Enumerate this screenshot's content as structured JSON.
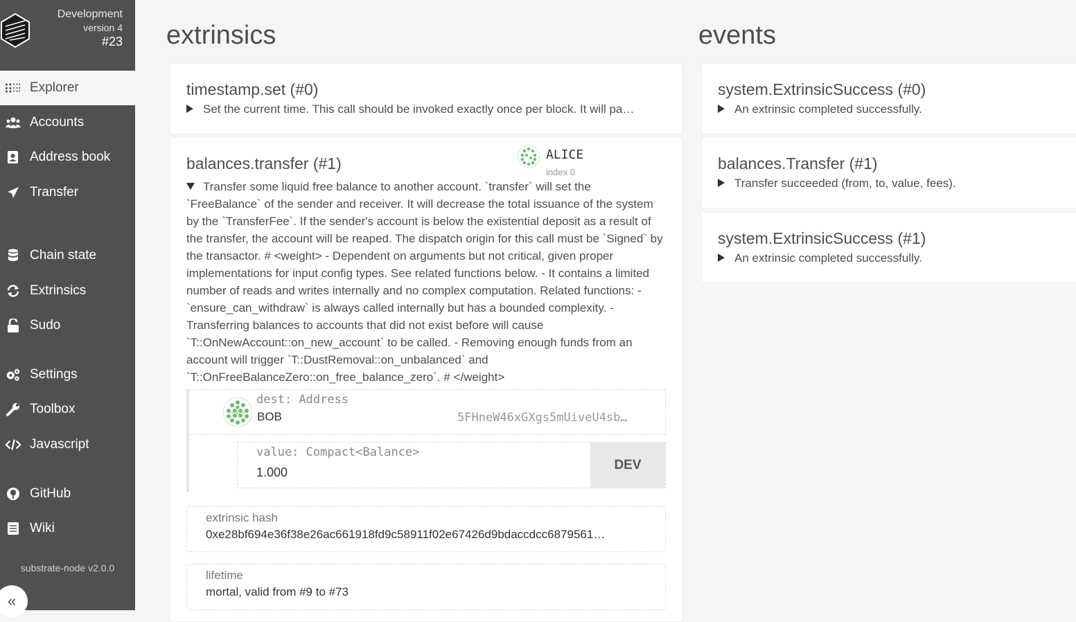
{
  "chain": {
    "name": "Development",
    "version": "version 4",
    "block": "#23"
  },
  "nav": {
    "explorer": "Explorer",
    "accounts": "Accounts",
    "address_book": "Address book",
    "transfer": "Transfer",
    "chain_state": "Chain state",
    "extrinsics": "Extrinsics",
    "sudo": "Sudo",
    "settings": "Settings",
    "toolbox": "Toolbox",
    "javascript": "Javascript",
    "github": "GitHub",
    "wiki": "Wiki"
  },
  "footer": {
    "node_version": "substrate-node v2.0.0",
    "collapse_label": "«"
  },
  "main": {
    "extrinsics_title": "extrinsics",
    "events_title": "events"
  },
  "extrinsics": [
    {
      "title": "timestamp.set (#0)",
      "desc": "Set the current time. This call should be invoked exactly once per block. It will pa…"
    },
    {
      "title": "balances.transfer (#1)",
      "signer_name": "ALICE",
      "signer_index": "index 0",
      "desc": "Transfer some liquid free balance to another account. `transfer` will set the `FreeBalance` of the sender and receiver. It will decrease the total issuance of the system by the `TransferFee`. If the sender's account is below the existential deposit as a result of the transfer, the account will be reaped. The dispatch origin for this call must be `Signed` by the transactor. # <weight> - Dependent on arguments but not critical, given proper implementations for input config types. See related functions below. - It contains a limited number of reads and writes internally and no complex computation. Related functions: - `ensure_can_withdraw` is always called internally but has a bounded complexity. - Transferring balances to accounts that did not exist before will cause `T::OnNewAccount::on_new_account` to be called. - Removing enough funds from an account will trigger `T::DustRemoval::on_unbalanced` and `T::OnFreeBalanceZero::on_free_balance_zero`. # </weight>",
      "dest_label": "dest: Address",
      "dest_name": "BOB",
      "dest_address": "5FHneW46xGXgs5mUiveU4sb…",
      "value_label": "value: Compact<Balance>",
      "value": "1.000",
      "unit": "DEV",
      "hash_label": "extrinsic hash",
      "hash": "0xe28bf694e36f38e26ac661918fd9c58911f02e67426d9bdaccdcc6879561…",
      "lifetime_label": "lifetime",
      "lifetime": "mortal, valid from #9 to #73"
    }
  ],
  "events": [
    {
      "title": "system.ExtrinsicSuccess (#0)",
      "desc": "An extrinsic completed successfully."
    },
    {
      "title": "balances.Transfer (#1)",
      "desc": "Transfer succeeded (from, to, value, fees)."
    },
    {
      "title": "system.ExtrinsicSuccess (#1)",
      "desc": "An extrinsic completed successfully."
    }
  ]
}
